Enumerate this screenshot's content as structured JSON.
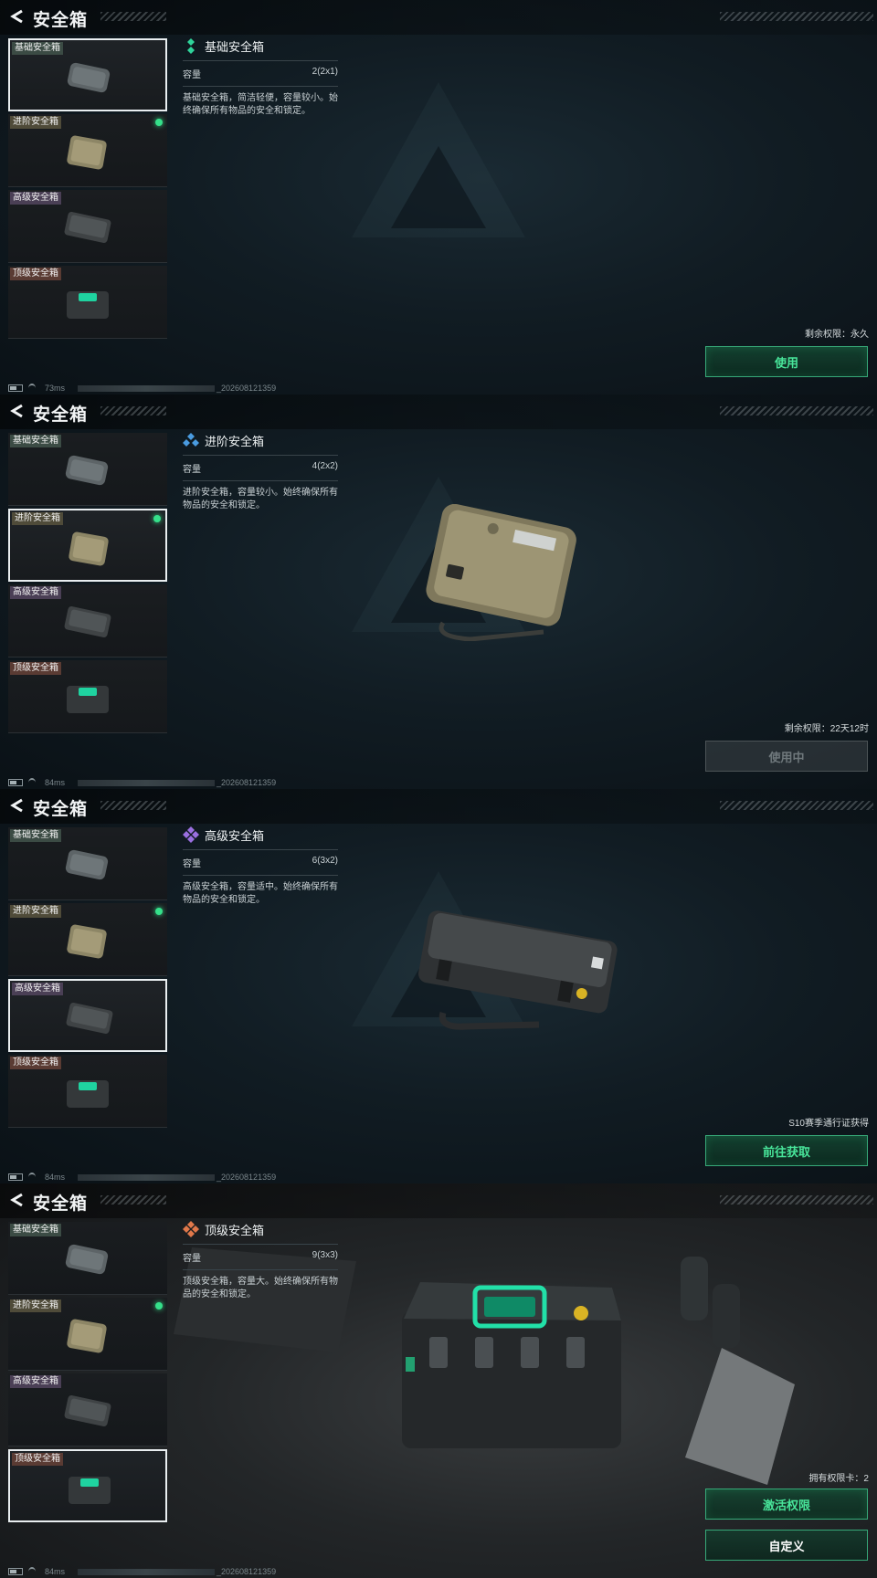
{
  "page_title": "安全箱",
  "tier_tags": [
    "基础安全箱",
    "进阶安全箱",
    "高级安全箱",
    "顶级安全箱"
  ],
  "colors": {
    "accent_green": "#35e08a",
    "button_green": "#48e59a"
  },
  "panels": [
    {
      "selected": 0,
      "name": "基础安全箱",
      "rank_icon": "basic-rank-icon",
      "capacity_label": "容量",
      "capacity_value": "2(2x1)",
      "description": "基础安全箱，简洁轻便，容量较小。始终确保所有物品的安全和锁定。",
      "status": "剩余权限：永久",
      "buttons": [
        "使用"
      ],
      "ping": "73ms",
      "build_id": "_202608121359"
    },
    {
      "selected": 1,
      "name": "进阶安全箱",
      "rank_icon": "advanced-rank-icon",
      "capacity_label": "容量",
      "capacity_value": "4(2x2)",
      "description": "进阶安全箱，容量较小。始终确保所有物品的安全和锁定。",
      "status": "剩余权限：22天12时",
      "buttons": [
        "使用中"
      ],
      "ping": "84ms",
      "build_id": "_202608121359"
    },
    {
      "selected": 2,
      "name": "高级安全箱",
      "rank_icon": "high-rank-icon",
      "capacity_label": "容量",
      "capacity_value": "6(3x2)",
      "description": "高级安全箱，容量适中。始终确保所有物品的安全和锁定。",
      "status": "S10赛季通行证获得",
      "buttons": [
        "前往获取"
      ],
      "ping": "84ms",
      "build_id": "_202608121359"
    },
    {
      "selected": 3,
      "name": "顶级安全箱",
      "rank_icon": "top-rank-icon",
      "capacity_label": "容量",
      "capacity_value": "9(3x3)",
      "description": "顶级安全箱，容量大。始终确保所有物品的安全和锁定。",
      "status": "拥有权限卡：2",
      "buttons": [
        "激活权限",
        "自定义"
      ],
      "ping": "84ms",
      "build_id": "_202608121359"
    }
  ]
}
